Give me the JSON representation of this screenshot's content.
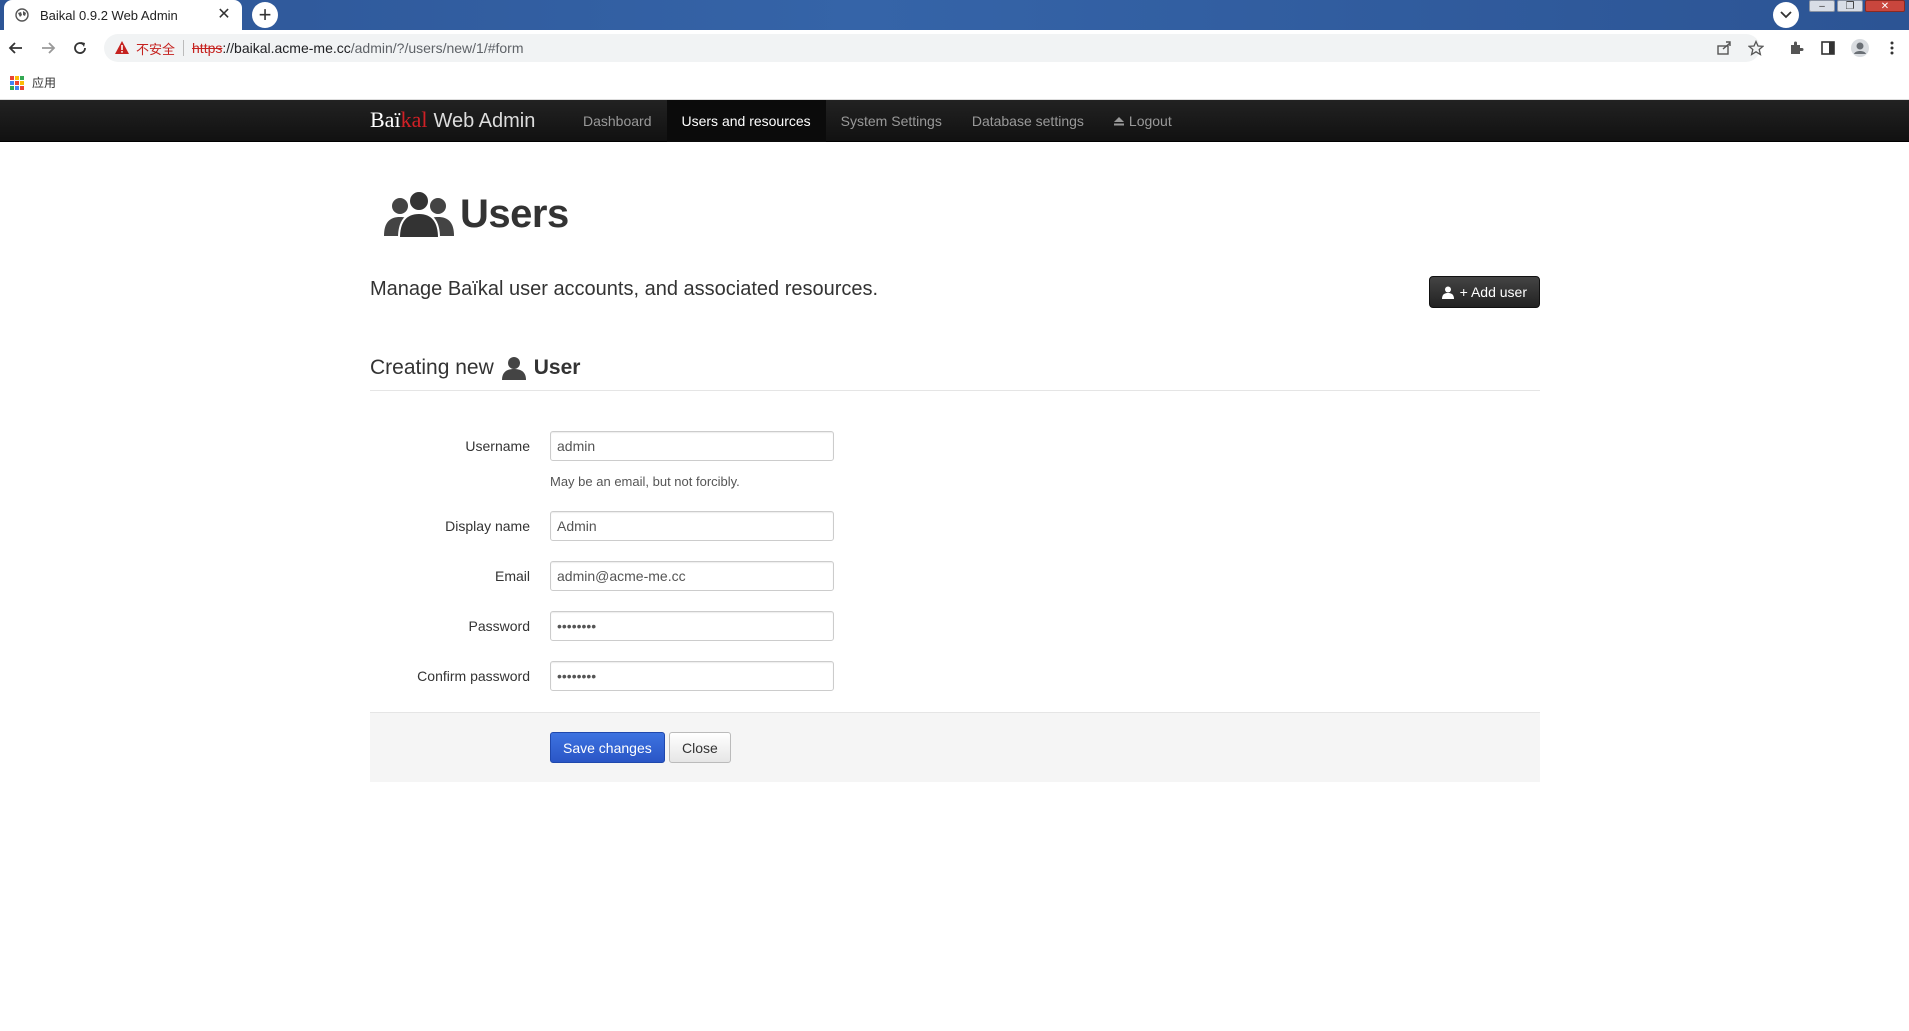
{
  "browser": {
    "tab_title": "Baikal 0.9.2 Web Admin",
    "tab_close": "✕",
    "new_tab": "+",
    "insecure_label": "不安全",
    "url_scheme": "https",
    "url_host": "://baikal.acme-me.cc",
    "url_path": "/admin/?/users/new/1/#form",
    "bookmarks_apps_label": "应用",
    "colors": {
      "tabstrip": "#2d5596",
      "insecure": "#c5221f"
    }
  },
  "navbar": {
    "brand_part1": "Baï",
    "brand_part2": "kal",
    "brand_part3": "Web Admin",
    "links": [
      {
        "label": "Dashboard"
      },
      {
        "label": "Users and resources"
      },
      {
        "label": "System Settings"
      },
      {
        "label": "Database settings"
      },
      {
        "label": "Logout"
      }
    ],
    "logout_icon": "eject-icon",
    "active_index": 1
  },
  "page": {
    "title": "Users",
    "lead": "Manage Baïkal user accounts, and associated resources.",
    "add_user_label": "+ Add user"
  },
  "form": {
    "legend_prefix": "Creating new",
    "legend_entity": "User",
    "fields": [
      {
        "label": "Username",
        "value": "admin",
        "help": "May be an email, but not forcibly."
      },
      {
        "label": "Display name",
        "value": "Admin"
      },
      {
        "label": "Email",
        "value": "admin@acme-me.cc"
      },
      {
        "label": "Password",
        "value": "••••••••"
      },
      {
        "label": "Confirm password",
        "value": "••••••••"
      }
    ],
    "save_label": "Save changes",
    "close_label": "Close",
    "colors": {
      "primary": "#2a56c6"
    }
  }
}
